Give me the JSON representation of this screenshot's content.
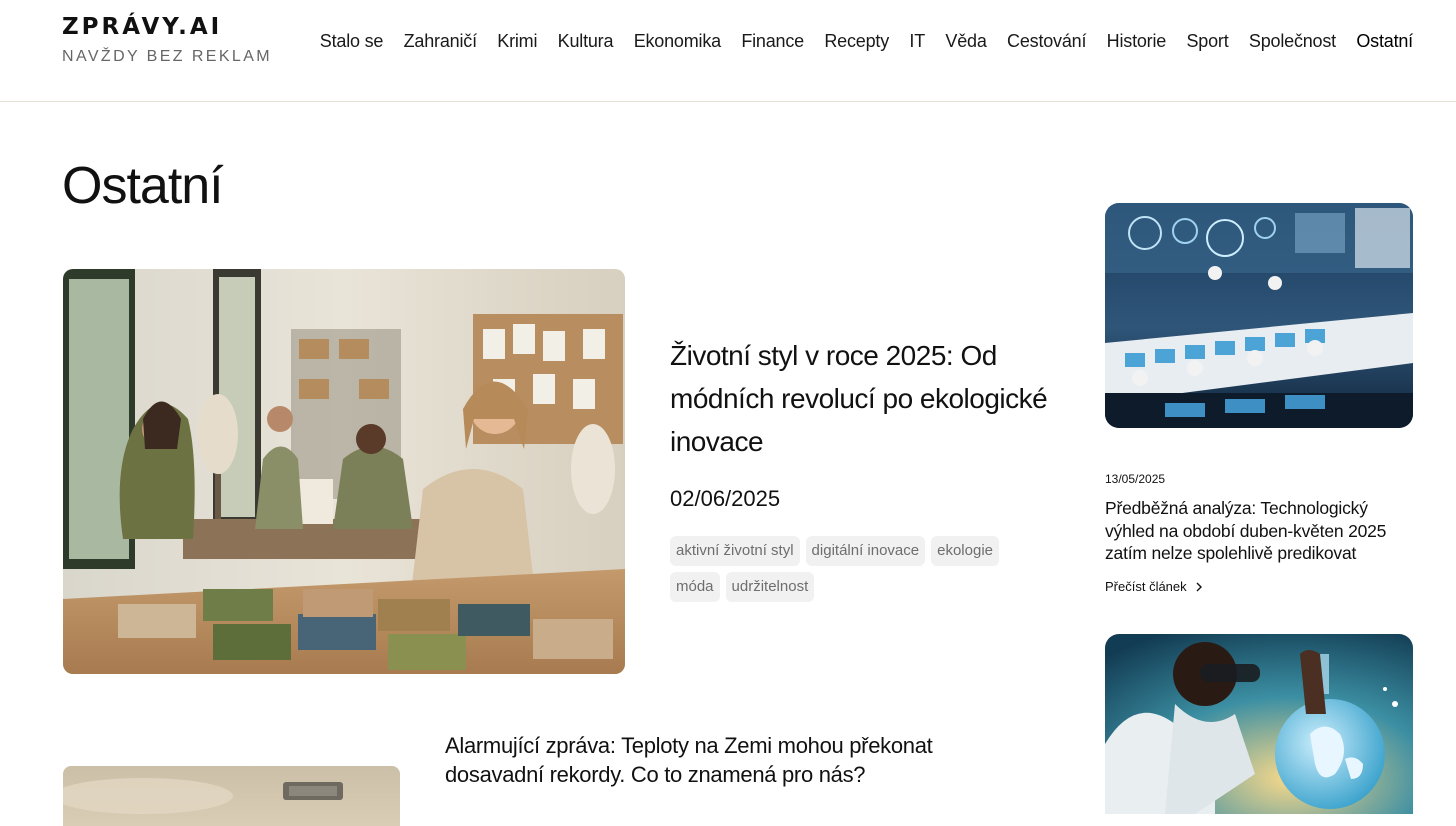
{
  "header": {
    "logo_title": "ZPRÁVY.AI",
    "logo_subtitle": "NAVŽDY BEZ REKLAM",
    "nav": [
      "Stalo se",
      "Zahraničí",
      "Krimi",
      "Kultura",
      "Ekonomika",
      "Finance",
      "Recepty",
      "IT",
      "Věda",
      "Cestování",
      "Historie",
      "Sport",
      "Společnost",
      "Ostatní"
    ],
    "active_nav": "Ostatní"
  },
  "page": {
    "title": "Ostatní"
  },
  "featured": {
    "title": "Životní styl v roce 2025: Od módních revolucí po ekologické inovace",
    "date": "02/06/2025",
    "tags": [
      "aktivní životní styl",
      "digitální inovace",
      "ekologie",
      "móda",
      "udržitelnost"
    ],
    "image_icon": "fashion-workshop-image"
  },
  "second_article": {
    "title": "Alarmující zpráva: Teploty na Zemi mohou překonat dosavadní rekordy. Co to znamená pro nás?",
    "image_icon": "landscape-sign-image"
  },
  "sidebar": {
    "article1": {
      "date": "13/05/2025",
      "title": "Předběžná analýza: Technologický výhled na období duben-květen 2025 zatím nelze spolehlivě predikovat",
      "read_more": "Přečíst článek",
      "image_icon": "tech-lab-image"
    },
    "article2": {
      "image_icon": "scientist-globe-flask-image"
    }
  },
  "colors": {
    "header_border": "#e6e3d6",
    "tag_bg": "#f1f1f1",
    "tag_text": "#6e6e6e"
  }
}
